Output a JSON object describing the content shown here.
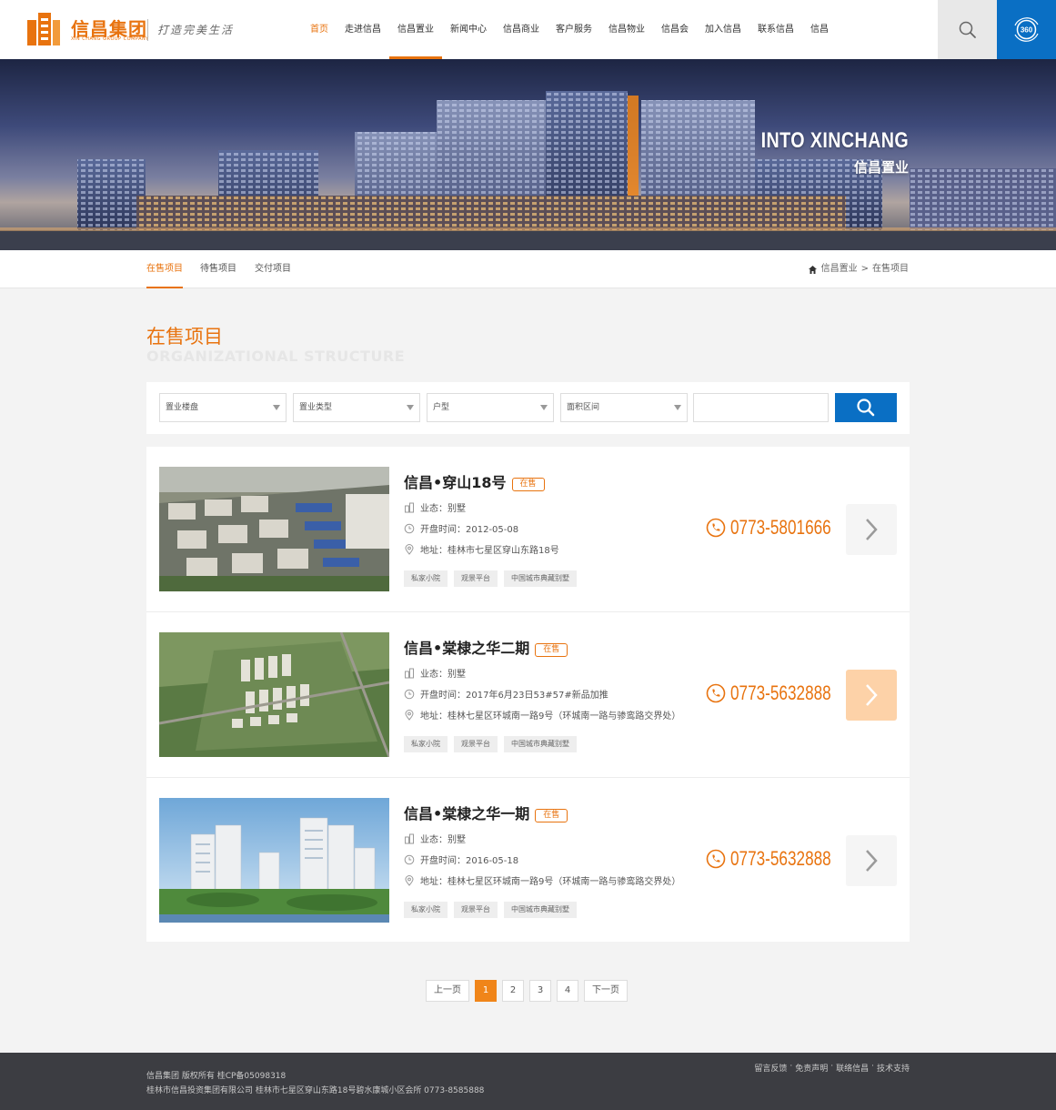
{
  "brand": {
    "name": "信昌集团",
    "name_en": "XIN CHANG GROUP COMPANY",
    "slogan": "打造完美生活"
  },
  "colors": {
    "accent": "#e8730f",
    "blue": "#0a6fc4",
    "footer": "#3c3d42"
  },
  "nav": [
    {
      "label": "首页",
      "active": true
    },
    {
      "label": "走进信昌"
    },
    {
      "label": "信昌置业",
      "highlighted": true
    },
    {
      "label": "新闻中心"
    },
    {
      "label": "信昌商业"
    },
    {
      "label": "客户服务"
    },
    {
      "label": "信昌物业"
    },
    {
      "label": "信昌会"
    },
    {
      "label": "加入信昌"
    },
    {
      "label": "联系信昌"
    },
    {
      "label": "信昌"
    }
  ],
  "header_icons": {
    "search": "search-icon",
    "pano": "360",
    "pano_icon": "panorama-360-icon"
  },
  "banner": {
    "title": "INTO XINCHANG",
    "subtitle": "信昌置业"
  },
  "subnav": {
    "tabs": [
      {
        "label": "在售项目",
        "active": true
      },
      {
        "label": "待售项目"
      },
      {
        "label": "交付项目"
      }
    ],
    "breadcrumb": {
      "home": "信昌置业",
      "sep": ">",
      "current": "在售项目"
    }
  },
  "section": {
    "title": "在售项目",
    "subtitle": "ORGANIZATIONAL STRUCTURE"
  },
  "filter": {
    "selects": [
      "置业楼盘",
      "置业类型",
      "户型",
      "面积区间"
    ],
    "keyword": "",
    "search_icon": "search-icon"
  },
  "projects": [
    {
      "name": "信昌•穿山18号",
      "status": "在售",
      "type": "业态：别墅",
      "open_date": "开盘时间：2012-05-08",
      "address": "地址：桂林市七星区穿山东路18号",
      "tags": [
        "私家小院",
        "观景平台",
        "中国城市典藏别墅"
      ],
      "phone": "0773-5801666"
    },
    {
      "name": "信昌•棠棣之华二期",
      "status": "在售",
      "type": "业态：别墅",
      "open_date": "开盘时间：2017年6月23日53#57#新品加推",
      "address": "地址：桂林七星区环城南一路9号（环城南一路与骖鸾路交界处）",
      "tags": [
        "私家小院",
        "观景平台",
        "中国城市典藏别墅"
      ],
      "phone": "0773-5632888"
    },
    {
      "name": "信昌•棠棣之华一期",
      "status": "在售",
      "type": "业态：别墅",
      "open_date": "开盘时间：2016-05-18",
      "address": "地址：桂林七星区环城南一路9号（环城南一路与骖鸾路交界处）",
      "tags": [
        "私家小院",
        "观景平台",
        "中国城市典藏别墅"
      ],
      "phone": "0773-5632888"
    }
  ],
  "pager": {
    "prev": "上一页",
    "pages": [
      "1",
      "2",
      "3",
      "4"
    ],
    "current": "1",
    "next": "下一页"
  },
  "footer": {
    "line1": "信昌集团  版权所有    桂CP备05098318",
    "line2": "桂林市信昌投资集团有限公司  桂林市七星区穿山东路18号碧水康城小区会所  0773-8585888",
    "links": [
      "留言反馈",
      "免责声明",
      "联络信昌",
      "技术支持"
    ],
    "link_sep": "·"
  }
}
